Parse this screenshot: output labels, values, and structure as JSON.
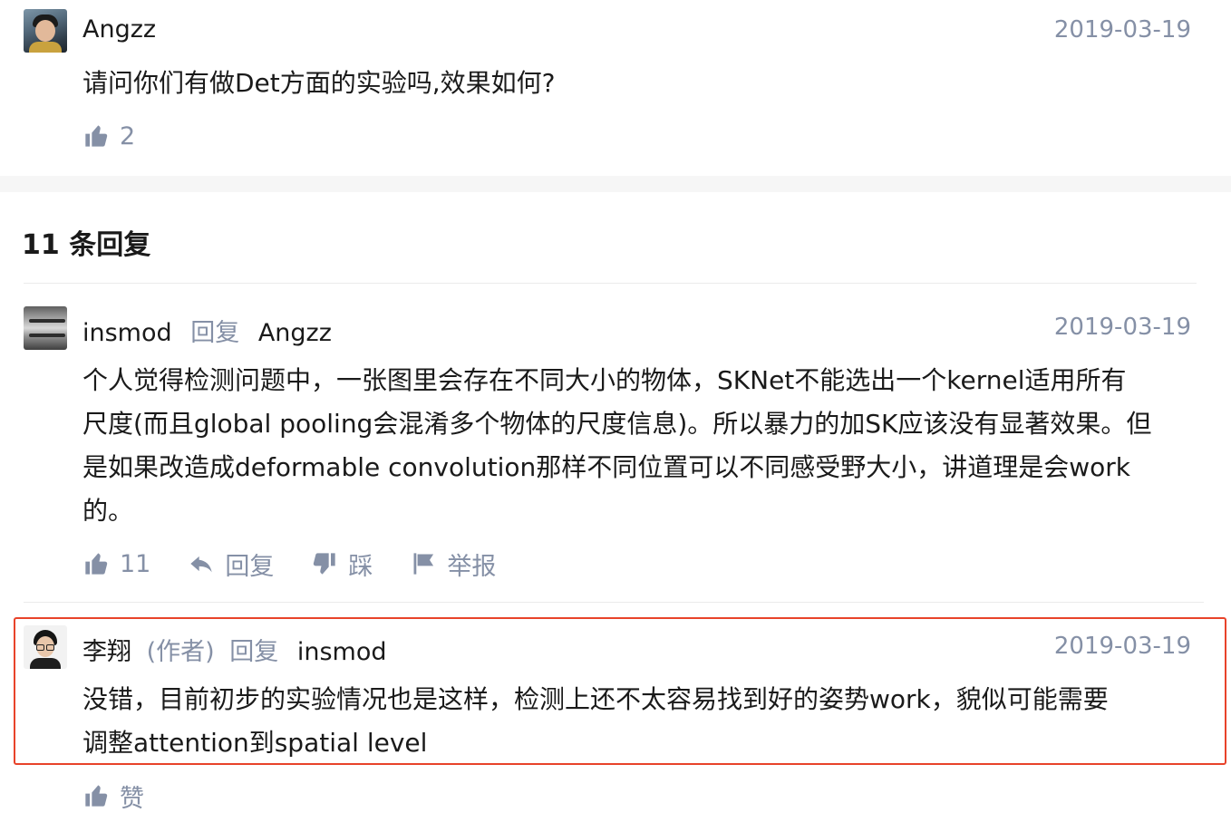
{
  "main_comment": {
    "author": "Angzz",
    "date": "2019-03-19",
    "text": "请问你们有做Det方面的实验吗,效果如何?",
    "like_count": "2"
  },
  "replies_header": "11 条回复",
  "reply_1": {
    "author": "insmod",
    "reply_word": "回复",
    "reply_to": "Angzz",
    "date": "2019-03-19",
    "lines": [
      "个人觉得检测问题中，一张图里会存在不同大小的物体，SKNet不能选出一个kernel适用所有",
      "尺度(而且global pooling会混淆多个物体的尺度信息)。所以暴力的加SK应该没有显著效果。但",
      "是如果改造成deformable convolution那样不同位置可以不同感受野大小，讲道理是会work",
      "的。"
    ],
    "like_count": "11",
    "reply_label": "回复",
    "dislike_label": "踩",
    "report_label": "举报"
  },
  "reply_2": {
    "author": "李翔",
    "author_tag": "(作者)",
    "reply_word": "回复",
    "reply_to": "insmod",
    "date": "2019-03-19",
    "lines": [
      "没错，目前初步的实验情况也是这样，检测上还不太容易找到好的姿势work，貌似可能需要",
      "调整attention到spatial level"
    ],
    "like_label": "赞"
  },
  "icons": {
    "like": "thumbs-up-icon",
    "reply": "reply-arrow-icon",
    "dislike": "thumbs-down-icon",
    "report": "flag-icon"
  },
  "colors": {
    "text": "#1a1a1a",
    "muted": "#8590a6",
    "highlight_border": "#e8432a"
  }
}
